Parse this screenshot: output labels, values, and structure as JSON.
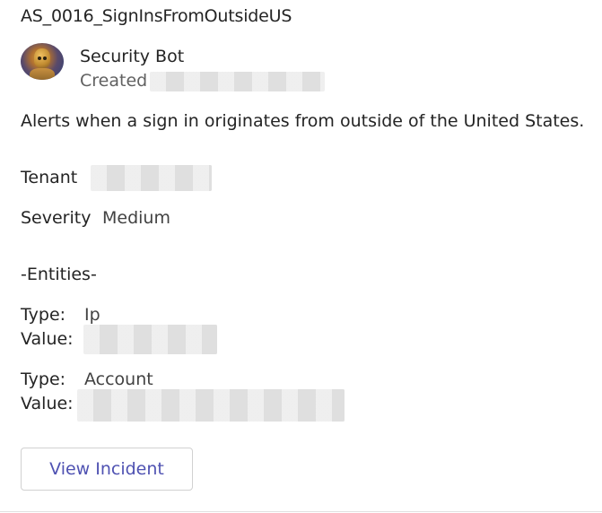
{
  "card": {
    "title": "AS_0016_SignInsFromOutsideUS",
    "bot_name": "Security Bot",
    "created_label": "Created",
    "description": "Alerts when a sign in originates from outside of the United States.",
    "tenant_label": "Tenant",
    "severity_label": "Severity",
    "severity_value": "Medium",
    "entities_heading": "-Entities-",
    "entities": [
      {
        "type_label": "Type:",
        "type_value": "Ip",
        "value_label": "Value:"
      },
      {
        "type_label": "Type:",
        "type_value": "Account",
        "value_label": "Value:"
      }
    ],
    "button_label": "View Incident"
  },
  "colors": {
    "button_text": "#4f52b2",
    "text": "#242424",
    "muted_text": "#616161"
  }
}
